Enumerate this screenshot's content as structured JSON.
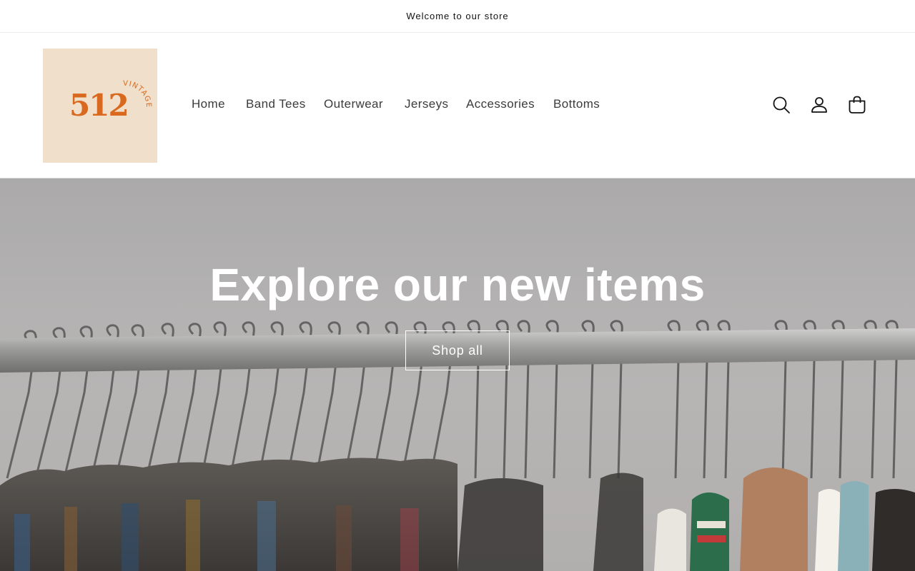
{
  "announcement": {
    "text": "Welcome to our store"
  },
  "logo": {
    "number": "512",
    "word": "VINTAGE",
    "bg_color": "#f0dfca",
    "text_color": "#d8691e"
  },
  "nav": {
    "items": [
      {
        "label": "Home"
      },
      {
        "label": "Band Tees"
      },
      {
        "label": "Outerwear"
      },
      {
        "label": "Jerseys"
      },
      {
        "label": "Accessories"
      },
      {
        "label": "Bottoms"
      }
    ]
  },
  "header_icons": [
    "search-icon",
    "account-icon",
    "cart-icon"
  ],
  "hero": {
    "title": "Explore our new items",
    "button_label": "Shop all"
  }
}
